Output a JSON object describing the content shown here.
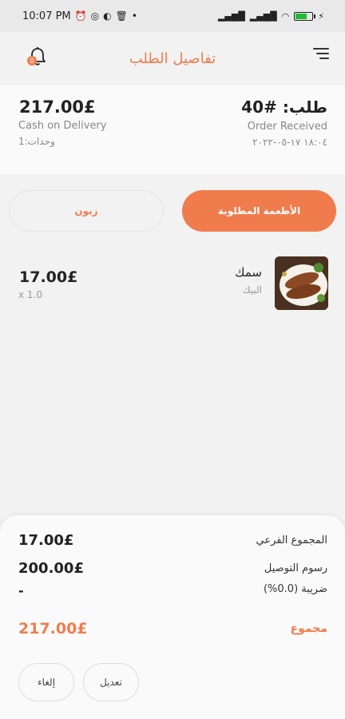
{
  "status_bar": {
    "time": "10:07 PM",
    "icons": [
      "alarm-icon",
      "whatsapp-icon",
      "vpn-icon",
      "delete-icon"
    ],
    "right_icons": [
      "signal-icon",
      "signal-icon",
      "wifi-icon",
      "battery-icon",
      "charging-icon"
    ],
    "battery_percent": 70,
    "battery_color": "#1cbf3a",
    "dot": "•"
  },
  "header": {
    "title": "تفاصيل الطلب",
    "notification_badge": "0",
    "accent_color": "#f07c4e"
  },
  "summary": {
    "total": "217.00£",
    "payment_method": "Cash on Delivery",
    "units": "وحدات:1",
    "order_id": "طلب: #40",
    "status": "Order Received",
    "date": "١٨:٠٤ ١٧-٠٥-٢٠٢٢"
  },
  "tabs": {
    "ordered_items": "الأطعمة المطلوبة",
    "customer": "زبون"
  },
  "items": [
    {
      "price": "17.00£",
      "quantity": "x 1.0",
      "name": "سمك",
      "restaurant": "البيك"
    }
  ],
  "totals": {
    "subtotal_label": "المجموع الفرعي",
    "subtotal_value": "17.00£",
    "delivery_label": "رسوم التوصيل",
    "delivery_value": "200.00£",
    "tax_label": "ضريبة (0.0%)",
    "tax_value": "-",
    "total_label": "مجموع",
    "total_value": "217.00£"
  },
  "actions": {
    "edit": "تعديل",
    "cancel": "إلغاء"
  }
}
